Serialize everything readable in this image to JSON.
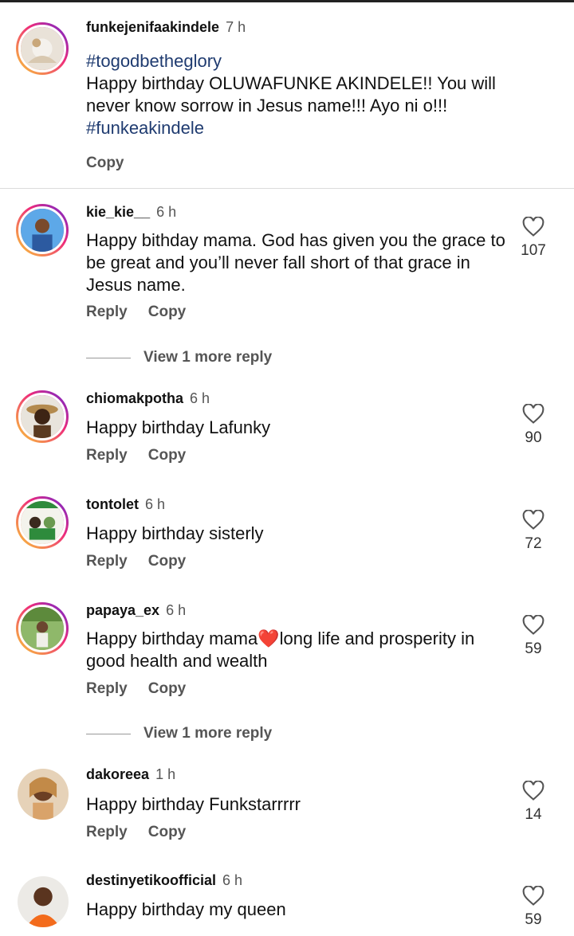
{
  "caption": {
    "username": "funkejenifaakindele",
    "time": "7 h",
    "hashtag1": "#togodbetheglory",
    "text": "Happy birthday OLUWAFUNKE AKINDELE!! You will never know sorrow in Jesus name!!! Ayo ni o!!!",
    "hashtag2": "#funkeakindele",
    "copy_label": "Copy"
  },
  "actions": {
    "reply": "Reply",
    "copy": "Copy"
  },
  "comments": [
    {
      "username": "kie_kie__",
      "time": "6 h",
      "text": "Happy bithday mama. God has given you the grace to be great and you’ll never fall short of that grace in Jesus name.",
      "likes": "107",
      "view_more": "View 1 more reply"
    },
    {
      "username": "chiomakpotha",
      "time": "6 h",
      "text": "Happy birthday Lafunky",
      "likes": "90"
    },
    {
      "username": "tontolet",
      "time": "6 h",
      "text": "Happy birthday sisterly",
      "likes": "72"
    },
    {
      "username": "papaya_ex",
      "time": "6 h",
      "text_before": "Happy birthday mama",
      "emoji": "❤️",
      "text_after": "long life and prosperity in good health and wealth",
      "likes": "59",
      "view_more": "View 1 more reply"
    },
    {
      "username": "dakoreea",
      "time": "1 h",
      "text": "Happy birthday Funkstarrrrr",
      "likes": "14"
    },
    {
      "username": "destinyetikoofficial",
      "time": "6 h",
      "text": "Happy birthday my queen",
      "likes": "59"
    }
  ],
  "colors": {
    "hashtag": "#1f3b70",
    "story_ring": [
      "#f9ce34",
      "#ee2a7b",
      "#6228d7"
    ],
    "heart_emoji": "#e0245e"
  }
}
